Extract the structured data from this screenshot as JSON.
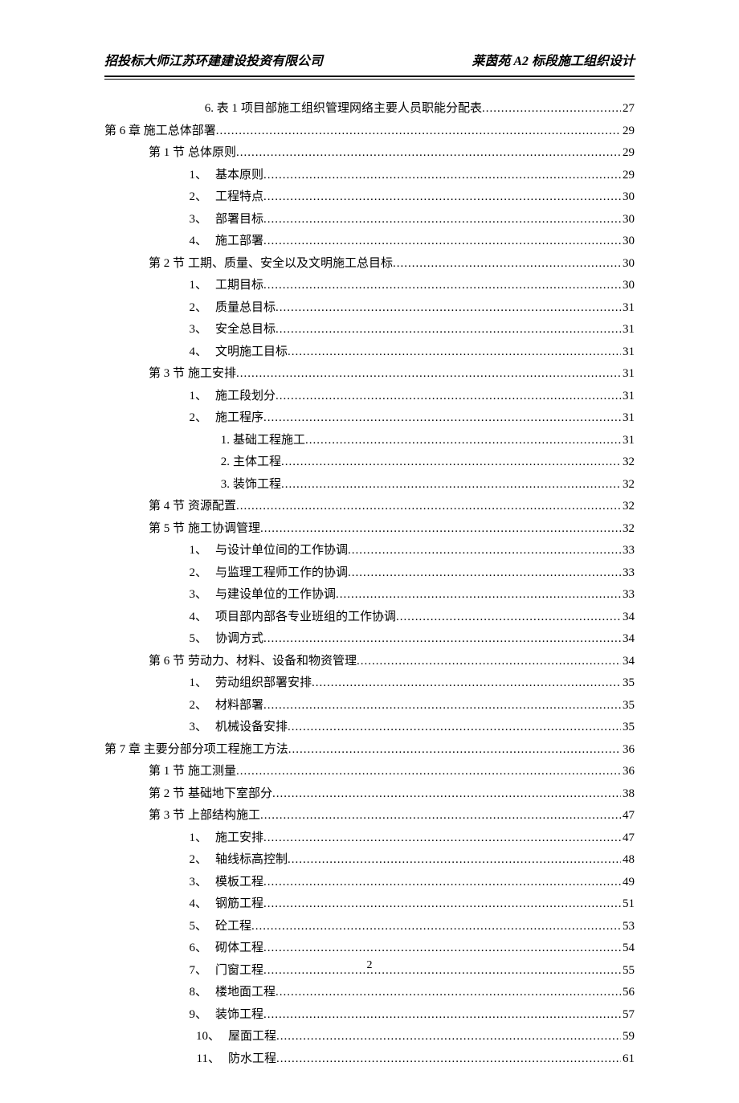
{
  "header_left": "招投标大师江苏环建建设投资有限公司",
  "header_right": "莱茵苑 A2 标段施工组织设计",
  "page_number": "2",
  "toc": [
    {
      "indent": "indent-special",
      "label": "6. 表 1",
      "text": "项目部施工组织管理网络主要人员职能分配表",
      "page": "27"
    },
    {
      "indent": "indent-0",
      "label": "第 6 章",
      "text": " 施工总体部署",
      "page": "29"
    },
    {
      "indent": "indent-1",
      "label": "第 1 节",
      "text": "总体原则",
      "page": "29"
    },
    {
      "indent": "indent-2",
      "label": "1、",
      "text": "基本原则",
      "page": "29"
    },
    {
      "indent": "indent-2",
      "label": "2、",
      "text": "工程特点",
      "page": "30"
    },
    {
      "indent": "indent-2",
      "label": "3、",
      "text": "部署目标",
      "page": "30"
    },
    {
      "indent": "indent-2",
      "label": "4、",
      "text": "施工部署",
      "page": "30"
    },
    {
      "indent": "indent-1",
      "label": "第 2 节",
      "text": "工期、质量、安全以及文明施工总目标",
      "page": "30"
    },
    {
      "indent": "indent-2",
      "label": "1、",
      "text": "工期目标",
      "page": "30"
    },
    {
      "indent": "indent-2",
      "label": "2、",
      "text": "质量总目标",
      "page": "31"
    },
    {
      "indent": "indent-2",
      "label": "3、",
      "text": "安全总目标",
      "page": "31"
    },
    {
      "indent": "indent-2",
      "label": "4、",
      "text": "文明施工目标",
      "page": "31"
    },
    {
      "indent": "indent-1",
      "label": "第 3 节",
      "text": "施工安排",
      "page": "31"
    },
    {
      "indent": "indent-2",
      "label": "1、",
      "text": "施工段划分",
      "page": "31"
    },
    {
      "indent": "indent-2",
      "label": "2、",
      "text": "施工程序",
      "page": "31"
    },
    {
      "indent": "indent-3",
      "label": "1.",
      "text": "基础工程施工",
      "page": "31"
    },
    {
      "indent": "indent-3",
      "label": "2.",
      "text": "主体工程",
      "page": "32"
    },
    {
      "indent": "indent-3",
      "label": "3.",
      "text": "装饰工程",
      "page": "32"
    },
    {
      "indent": "indent-1",
      "label": "第 4 节",
      "text": "资源配置",
      "page": "32"
    },
    {
      "indent": "indent-1",
      "label": "第 5 节",
      "text": "施工协调管理",
      "page": "32"
    },
    {
      "indent": "indent-2",
      "label": "1、",
      "text": "与设计单位间的工作协调",
      "page": "33"
    },
    {
      "indent": "indent-2",
      "label": "2、",
      "text": "与监理工程师工作的协调",
      "page": "33"
    },
    {
      "indent": "indent-2",
      "label": "3、",
      "text": "与建设单位的工作协调",
      "page": "33"
    },
    {
      "indent": "indent-2",
      "label": "4、",
      "text": "项目部内部各专业班组的工作协调",
      "page": "34"
    },
    {
      "indent": "indent-2",
      "label": "5、",
      "text": "协调方式",
      "page": "34"
    },
    {
      "indent": "indent-1",
      "label": "第 6 节",
      "text": "劳动力、材料、设备和物资管理",
      "page": "34"
    },
    {
      "indent": "indent-2",
      "label": "1、",
      "text": "劳动组织部署安排",
      "page": "35"
    },
    {
      "indent": "indent-2",
      "label": "2、",
      "text": "材料部署",
      "page": "35"
    },
    {
      "indent": "indent-2",
      "label": "3、",
      "text": "机械设备安排",
      "page": "35"
    },
    {
      "indent": "indent-0",
      "label": "第 7 章",
      "text": " 主要分部分项工程施工方法",
      "page": "36"
    },
    {
      "indent": "indent-1",
      "label": "第 1 节",
      "text": "施工测量",
      "page": "36"
    },
    {
      "indent": "indent-1",
      "label": "第 2 节",
      "text": "基础地下室部分",
      "page": "38"
    },
    {
      "indent": "indent-1",
      "label": "第 3 节",
      "text": "上部结构施工",
      "page": "47"
    },
    {
      "indent": "indent-2",
      "label": "1、",
      "text": "施工安排",
      "page": "47"
    },
    {
      "indent": "indent-2",
      "label": "2、",
      "text": "轴线标高控制",
      "page": "48"
    },
    {
      "indent": "indent-2",
      "label": "3、",
      "text": "模板工程",
      "page": "49"
    },
    {
      "indent": "indent-2",
      "label": "4、",
      "text": "钢筋工程",
      "page": "51"
    },
    {
      "indent": "indent-2",
      "label": "5、",
      "text": "砼工程",
      "page": "53"
    },
    {
      "indent": "indent-2",
      "label": "6、",
      "text": "砌体工程",
      "page": "54"
    },
    {
      "indent": "indent-2",
      "label": "7、",
      "text": "门窗工程",
      "page": "55"
    },
    {
      "indent": "indent-2",
      "label": "8、",
      "text": "楼地面工程",
      "page": "56"
    },
    {
      "indent": "indent-2",
      "label": "9、",
      "text": "装饰工程",
      "page": "57"
    },
    {
      "indent": "indent-2b",
      "label": "10、",
      "text": "屋面工程",
      "page": "59"
    },
    {
      "indent": "indent-2b",
      "label": "11、",
      "text": "防水工程",
      "page": "61"
    }
  ]
}
